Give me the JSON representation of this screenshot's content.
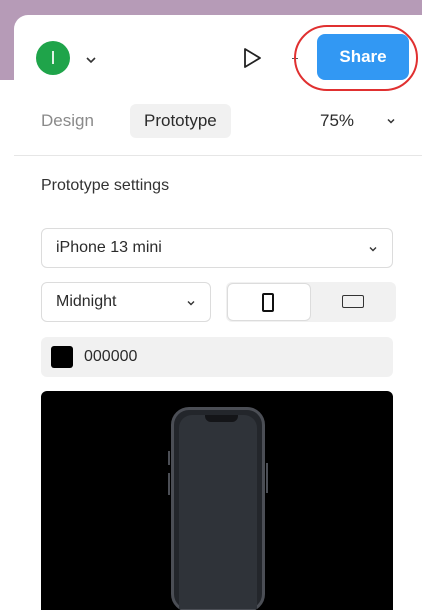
{
  "header": {
    "avatar_initial": "I",
    "share_label": "Share"
  },
  "tabs": [
    {
      "label": "Design",
      "active": false
    },
    {
      "label": "Prototype",
      "active": true
    }
  ],
  "zoom": {
    "value": "75%"
  },
  "prototype_settings": {
    "title": "Prototype settings",
    "device": "iPhone 13 mini",
    "model": "Midnight",
    "orientation": {
      "selected": "portrait",
      "options": [
        "portrait",
        "landscape"
      ]
    },
    "background_color": {
      "hex": "000000",
      "swatch": "#000000"
    }
  },
  "colors": {
    "accent": "#3298f3",
    "avatar": "#1fa44a",
    "highlight_ring": "#e03030"
  },
  "icons": [
    "avatar-caret-icon",
    "play-icon",
    "zoom-caret-icon",
    "select-chevron-icon",
    "portrait-icon",
    "landscape-icon",
    "phone-mockup"
  ]
}
